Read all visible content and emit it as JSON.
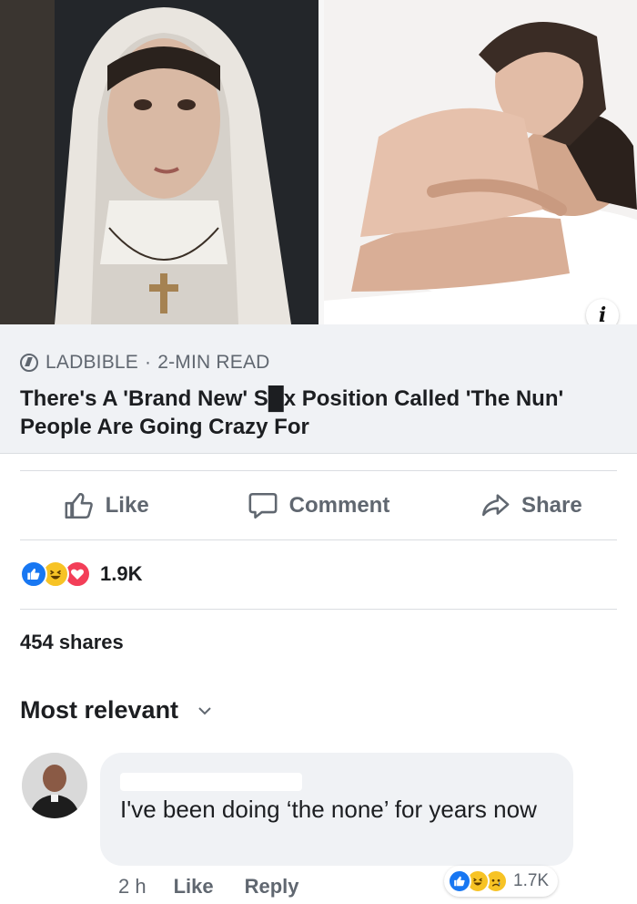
{
  "post": {
    "source": "LADBIBLE",
    "separator": "·",
    "read_time": "2-MIN READ",
    "headline": "There's A 'Brand New' S█x Position Called 'The Nun' People Are Going Crazy For",
    "info_icon": "i"
  },
  "actions": {
    "like": "Like",
    "comment": "Comment",
    "share": "Share"
  },
  "reactions": {
    "icons": [
      "like-icon",
      "haha-icon",
      "love-icon"
    ],
    "count": "1.9K"
  },
  "shares": "454 shares",
  "comments_filter": "Most relevant",
  "comment": {
    "text": "I've been doing ‘the none’ for years now",
    "time": "2 h",
    "like_label": "Like",
    "reply_label": "Reply",
    "reactions": {
      "icons": [
        "like-icon",
        "haha-icon",
        "sad-icon"
      ],
      "count": "1.7K"
    }
  },
  "colors": {
    "like_blue": "#1877f2",
    "haha_yellow": "#f7c325",
    "love_red": "#f33e58",
    "secondary_text": "#606770",
    "link_box_bg": "#f0f2f5"
  }
}
